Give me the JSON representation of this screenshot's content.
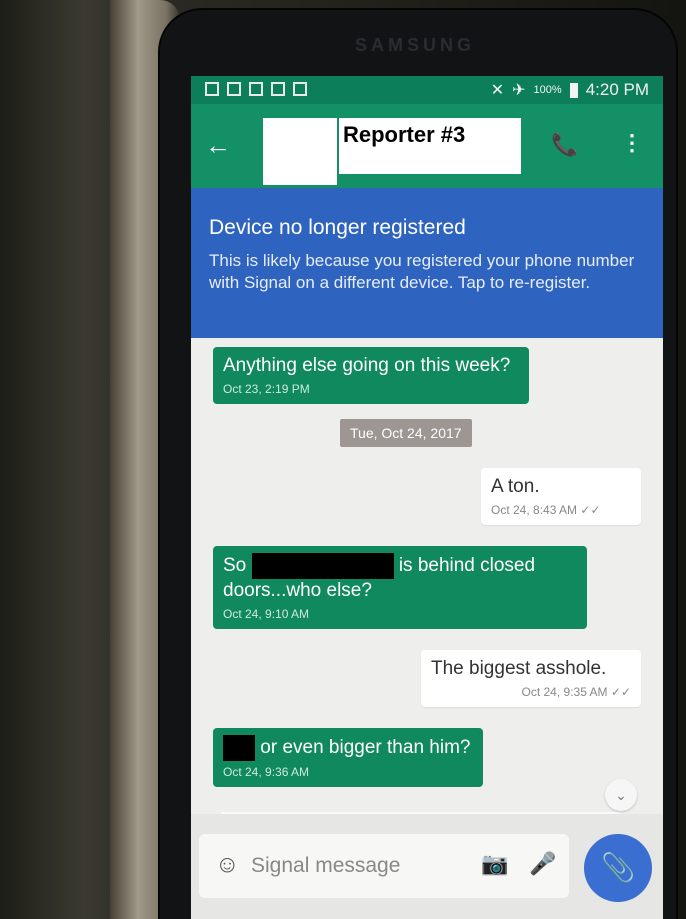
{
  "device": {
    "brand": "SAMSUNG"
  },
  "status_bar": {
    "battery": "100%",
    "time": "4:20 PM"
  },
  "toolbar": {
    "back_icon": "←",
    "title": "Reporter #3",
    "call_icon": "📞",
    "more_icon": "⋮"
  },
  "banner": {
    "title": "Device no longer registered",
    "body": "This is likely because you registered your phone number with Signal on a different device. Tap to re-register."
  },
  "messages": [
    {
      "dir": "in",
      "text": "Anything else going on this week?",
      "meta": "Oct 23, 2:19 PM"
    },
    {
      "dir": "date",
      "text": "Tue, Oct 24, 2017"
    },
    {
      "dir": "out",
      "text": "A ton.",
      "meta": "Oct 24, 8:43 AM"
    },
    {
      "dir": "in",
      "text_a": "So",
      "text_b": "is behind closed",
      "text_c": "doors...who else?",
      "meta": "Oct 24, 9:10 AM"
    },
    {
      "dir": "out",
      "text": "The biggest asshole.",
      "meta": "Oct 24, 9:35 AM"
    },
    {
      "dir": "in",
      "text": "or even bigger than him?",
      "meta": "Oct 24, 9:36 AM"
    }
  ],
  "composer": {
    "placeholder": "Signal message",
    "emoji_icon": "☺",
    "camera_icon": "📷",
    "mic_icon": "🎤",
    "attach_icon": "📎",
    "scroll_icon": "⌄"
  }
}
